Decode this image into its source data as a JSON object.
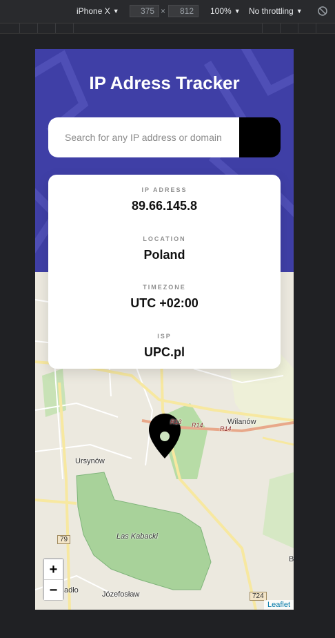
{
  "devtools": {
    "device": "iPhone X",
    "width": "375",
    "times": "×",
    "height": "812",
    "zoom": "100%",
    "throttling": "No throttling"
  },
  "app": {
    "title": "IP Adress Tracker",
    "search_placeholder": "Search for any IP address or domain",
    "submit_icon": "chevron-right-icon"
  },
  "info": [
    {
      "label": "IP ADRESS",
      "value": "89.66.145.8"
    },
    {
      "label": "LOCATION",
      "value": "Poland"
    },
    {
      "label": "TIMEZONE",
      "value": "UTC +02:00"
    },
    {
      "label": "ISP",
      "value": "UPC.pl"
    }
  ],
  "map": {
    "labels": [
      "Wilanów",
      "Ursynów",
      "Las Kabacki",
      "Józefosław",
      "adło",
      "B"
    ],
    "road_labels": [
      "R13",
      "R14",
      "R14"
    ],
    "shields": [
      "79",
      "724"
    ],
    "zoom_in": "+",
    "zoom_out": "−",
    "attribution": "Leaflet",
    "marker_icon": "location-pin-icon"
  },
  "colors": {
    "hero_bg": "#3f3fa6",
    "button_bg": "#000000",
    "forest": "#a8d29a"
  }
}
